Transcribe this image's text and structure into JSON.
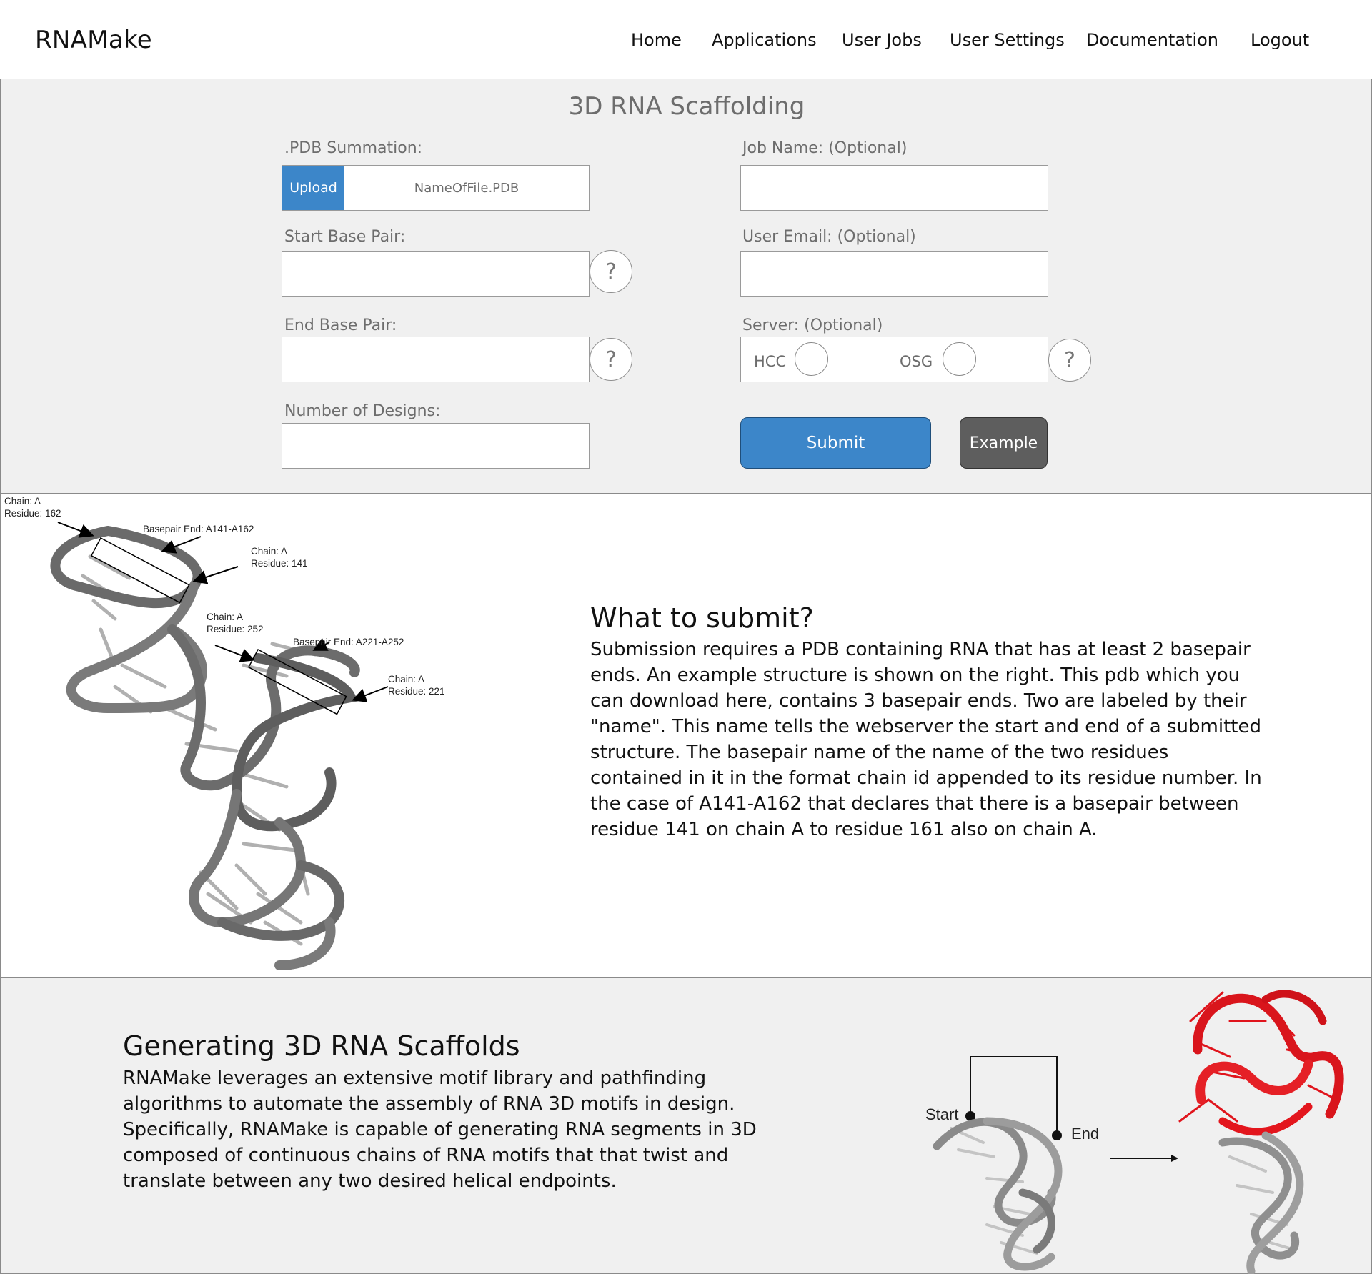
{
  "nav": {
    "brand": "RNAMake",
    "items": [
      "Home",
      "Applications",
      "User Jobs",
      "User Settings",
      "Documentation",
      "Logout"
    ]
  },
  "form": {
    "title": "3D RNA Scaffolding",
    "pdb_label": ".PDB Summation:",
    "upload_label": "Upload",
    "file_name": "NameOfFile.PDB",
    "job_name_label": "Job Name: (Optional)",
    "start_bp_label": "Start Base Pair:",
    "user_email_label": "User Email: (Optional)",
    "end_bp_label": "End Base Pair:",
    "server_label": "Server: (Optional)",
    "server_options": [
      "HCC",
      "OSG"
    ],
    "designs_label": "Number of Designs:",
    "help_glyph": "?",
    "submit_label": "Submit",
    "example_label": "Example"
  },
  "info": {
    "figure_annotations": {
      "chain_a_res_162": [
        "Chain: A",
        "Residue: 162"
      ],
      "bp_end_1": "Basepair End: A141-A162",
      "chain_a_res_141": [
        "Chain: A",
        "Residue: 141"
      ],
      "chain_a_res_252": [
        "Chain: A",
        "Residue: 252"
      ],
      "bp_end_2": "Basepair End: A221-A252",
      "chain_a_res_221": [
        "Chain: A",
        "Residue: 221"
      ]
    },
    "title": "What to submit?",
    "body": "Submission requires a PDB containing RNA that has at least 2 basepair ends. An example structure is shown on the right. This pdb which you can download here, contains 3 basepair ends. Two are labeled by their \"name\". This name tells the webserver the start and end of a submitted structure. The basepair name of the name of the two residues contained in it in the format chain id appended to its residue number. In the case of A141-A162 that declares that there is a basepair between residue 141 on chain A to residue 161 also on chain A."
  },
  "scaffold": {
    "title": "Generating 3D RNA Scaffolds",
    "body": "RNAMake leverages an extensive motif library and pathfinding algorithms to automate the assembly of RNA 3D motifs in design. Specifically, RNAMake is capable of generating RNA segments in 3D composed of continuous chains of RNA motifs that that twist and translate between any two desired helical endpoints.",
    "start_label": "Start",
    "end_label": "End"
  },
  "colors": {
    "accent_blue": "#3c86c9",
    "example_gray": "#5e5e5e",
    "panel_gray": "#f0f0f0",
    "rna_red": "#e0141c",
    "rna_gray": "#9a9a9a"
  }
}
